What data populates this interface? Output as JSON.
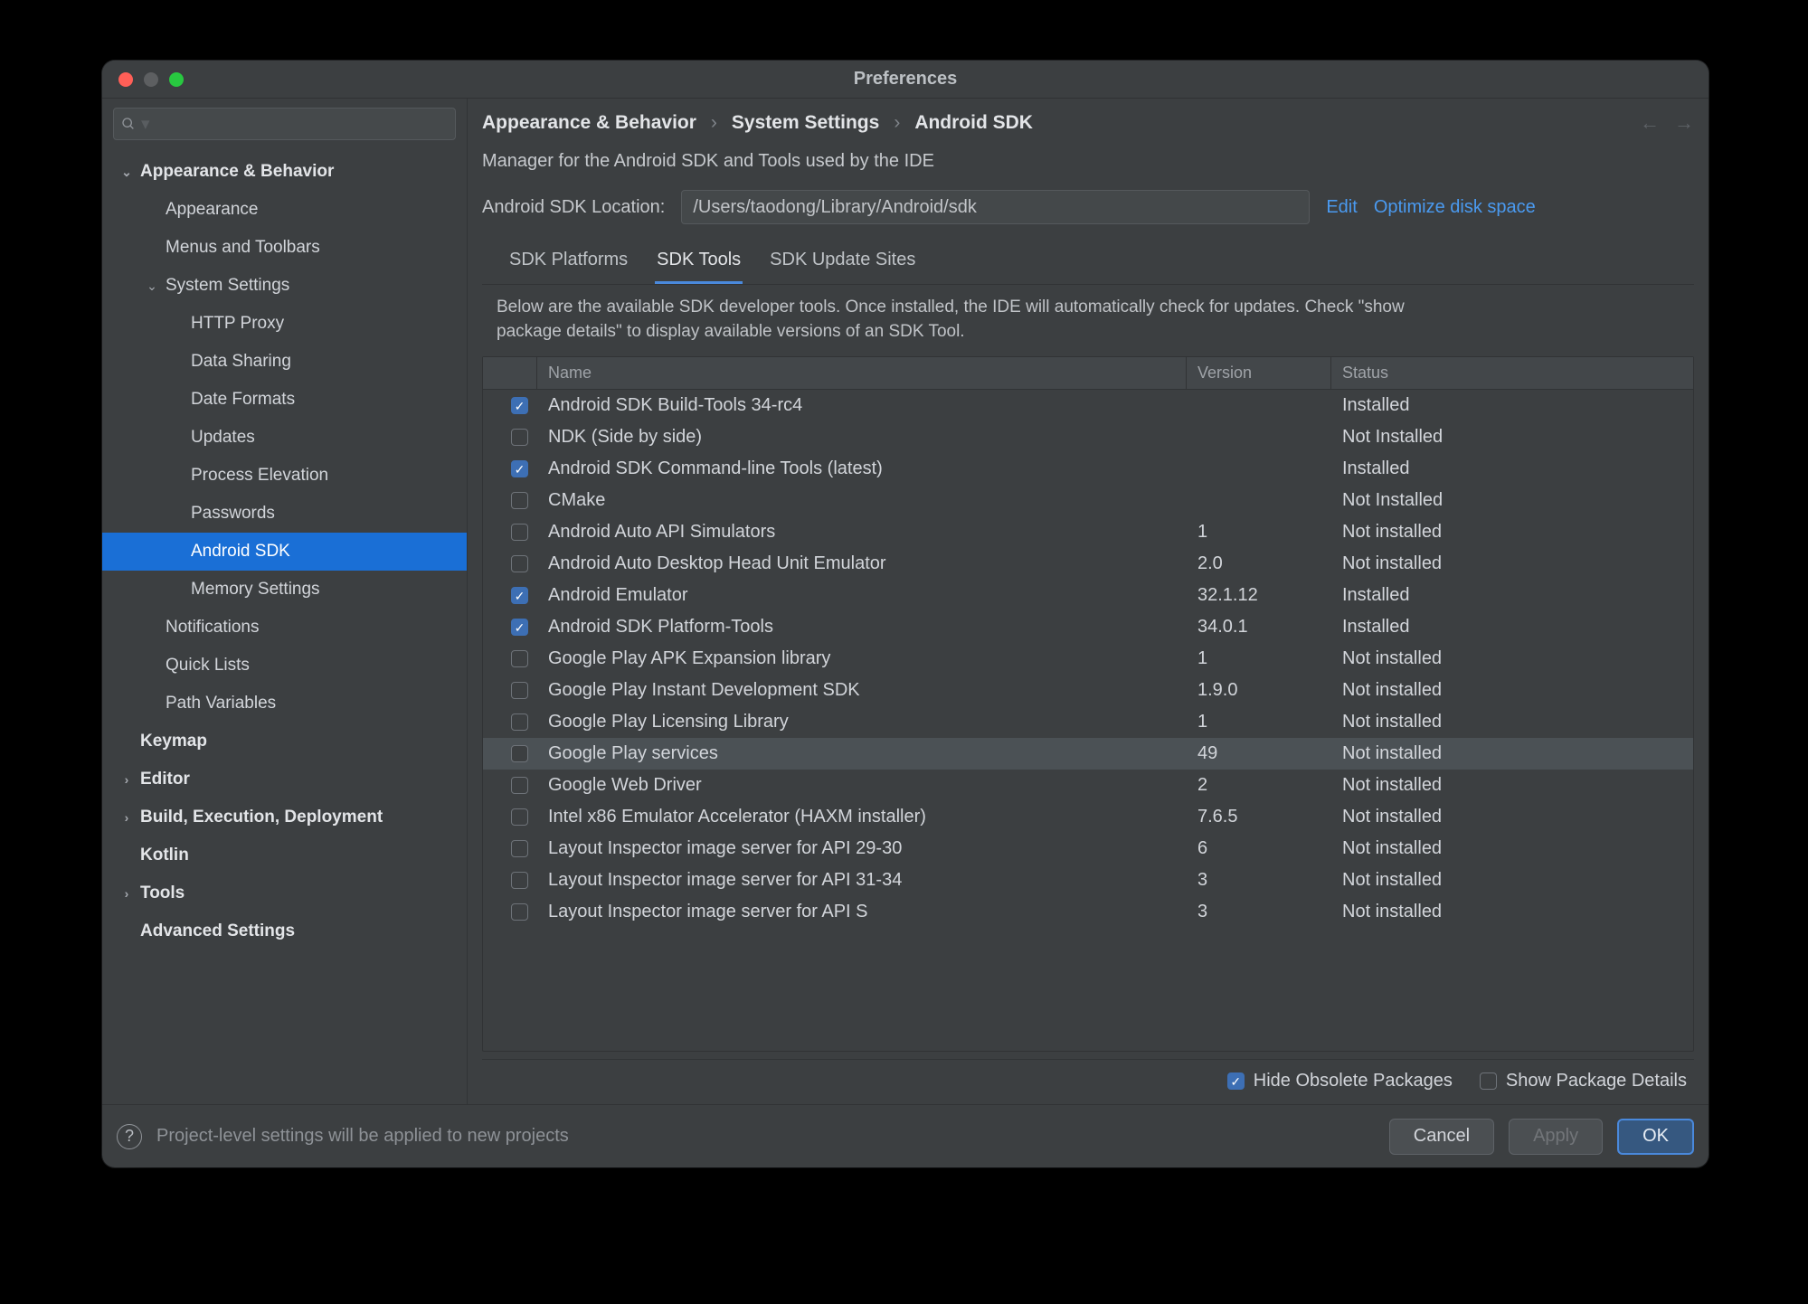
{
  "window": {
    "title": "Preferences"
  },
  "search": {
    "placeholder": ""
  },
  "sidebar": [
    {
      "label": "Appearance & Behavior",
      "indent": 0,
      "bold": true,
      "chev": "down"
    },
    {
      "label": "Appearance",
      "indent": 1,
      "bold": false,
      "chev": ""
    },
    {
      "label": "Menus and Toolbars",
      "indent": 1,
      "bold": false,
      "chev": ""
    },
    {
      "label": "System Settings",
      "indent": 1,
      "bold": false,
      "chev": "down"
    },
    {
      "label": "HTTP Proxy",
      "indent": 2,
      "bold": false,
      "chev": ""
    },
    {
      "label": "Data Sharing",
      "indent": 2,
      "bold": false,
      "chev": ""
    },
    {
      "label": "Date Formats",
      "indent": 2,
      "bold": false,
      "chev": ""
    },
    {
      "label": "Updates",
      "indent": 2,
      "bold": false,
      "chev": ""
    },
    {
      "label": "Process Elevation",
      "indent": 2,
      "bold": false,
      "chev": ""
    },
    {
      "label": "Passwords",
      "indent": 2,
      "bold": false,
      "chev": ""
    },
    {
      "label": "Android SDK",
      "indent": 2,
      "bold": false,
      "chev": "",
      "selected": true
    },
    {
      "label": "Memory Settings",
      "indent": 2,
      "bold": false,
      "chev": ""
    },
    {
      "label": "Notifications",
      "indent": 1,
      "bold": false,
      "chev": ""
    },
    {
      "label": "Quick Lists",
      "indent": 1,
      "bold": false,
      "chev": ""
    },
    {
      "label": "Path Variables",
      "indent": 1,
      "bold": false,
      "chev": ""
    },
    {
      "label": "Keymap",
      "indent": 0,
      "bold": true,
      "chev": ""
    },
    {
      "label": "Editor",
      "indent": 0,
      "bold": true,
      "chev": "right"
    },
    {
      "label": "Build, Execution, Deployment",
      "indent": 0,
      "bold": true,
      "chev": "right"
    },
    {
      "label": "Kotlin",
      "indent": 0,
      "bold": true,
      "chev": ""
    },
    {
      "label": "Tools",
      "indent": 0,
      "bold": true,
      "chev": "right"
    },
    {
      "label": "Advanced Settings",
      "indent": 0,
      "bold": true,
      "chev": ""
    }
  ],
  "breadcrumb": [
    "Appearance & Behavior",
    "System Settings",
    "Android SDK"
  ],
  "subtitle": "Manager for the Android SDK and Tools used by the IDE",
  "location": {
    "label": "Android SDK Location:",
    "value": "/Users/taodong/Library/Android/sdk",
    "edit": "Edit",
    "optimize": "Optimize disk space"
  },
  "tabs": {
    "items": [
      "SDK Platforms",
      "SDK Tools",
      "SDK Update Sites"
    ],
    "active": 1
  },
  "description": "Below are the available SDK developer tools. Once installed, the IDE will automatically check for updates. Check \"show package details\" to display available versions of an SDK Tool.",
  "table": {
    "headers": {
      "name": "Name",
      "version": "Version",
      "status": "Status"
    },
    "rows": [
      {
        "checked": true,
        "name": "Android SDK Build-Tools 34-rc4",
        "version": "",
        "status": "Installed"
      },
      {
        "checked": false,
        "name": "NDK (Side by side)",
        "version": "",
        "status": "Not Installed"
      },
      {
        "checked": true,
        "name": "Android SDK Command-line Tools (latest)",
        "version": "",
        "status": "Installed"
      },
      {
        "checked": false,
        "name": "CMake",
        "version": "",
        "status": "Not Installed"
      },
      {
        "checked": false,
        "name": "Android Auto API Simulators",
        "version": "1",
        "status": "Not installed"
      },
      {
        "checked": false,
        "name": "Android Auto Desktop Head Unit Emulator",
        "version": "2.0",
        "status": "Not installed"
      },
      {
        "checked": true,
        "name": "Android Emulator",
        "version": "32.1.12",
        "status": "Installed"
      },
      {
        "checked": true,
        "name": "Android SDK Platform-Tools",
        "version": "34.0.1",
        "status": "Installed"
      },
      {
        "checked": false,
        "name": "Google Play APK Expansion library",
        "version": "1",
        "status": "Not installed"
      },
      {
        "checked": false,
        "name": "Google Play Instant Development SDK",
        "version": "1.9.0",
        "status": "Not installed"
      },
      {
        "checked": false,
        "name": "Google Play Licensing Library",
        "version": "1",
        "status": "Not installed"
      },
      {
        "checked": false,
        "name": "Google Play services",
        "version": "49",
        "status": "Not installed",
        "hover": true
      },
      {
        "checked": false,
        "name": "Google Web Driver",
        "version": "2",
        "status": "Not installed"
      },
      {
        "checked": false,
        "name": "Intel x86 Emulator Accelerator (HAXM installer)",
        "version": "7.6.5",
        "status": "Not installed"
      },
      {
        "checked": false,
        "name": "Layout Inspector image server for API 29-30",
        "version": "6",
        "status": "Not installed"
      },
      {
        "checked": false,
        "name": "Layout Inspector image server for API 31-34",
        "version": "3",
        "status": "Not installed"
      },
      {
        "checked": false,
        "name": "Layout Inspector image server for API S",
        "version": "3",
        "status": "Not installed"
      }
    ]
  },
  "options": {
    "hide_obsolete": {
      "label": "Hide Obsolete Packages",
      "checked": true
    },
    "show_details": {
      "label": "Show Package Details",
      "checked": false
    }
  },
  "footer": {
    "message": "Project-level settings will be applied to new projects",
    "cancel": "Cancel",
    "apply": "Apply",
    "ok": "OK"
  }
}
